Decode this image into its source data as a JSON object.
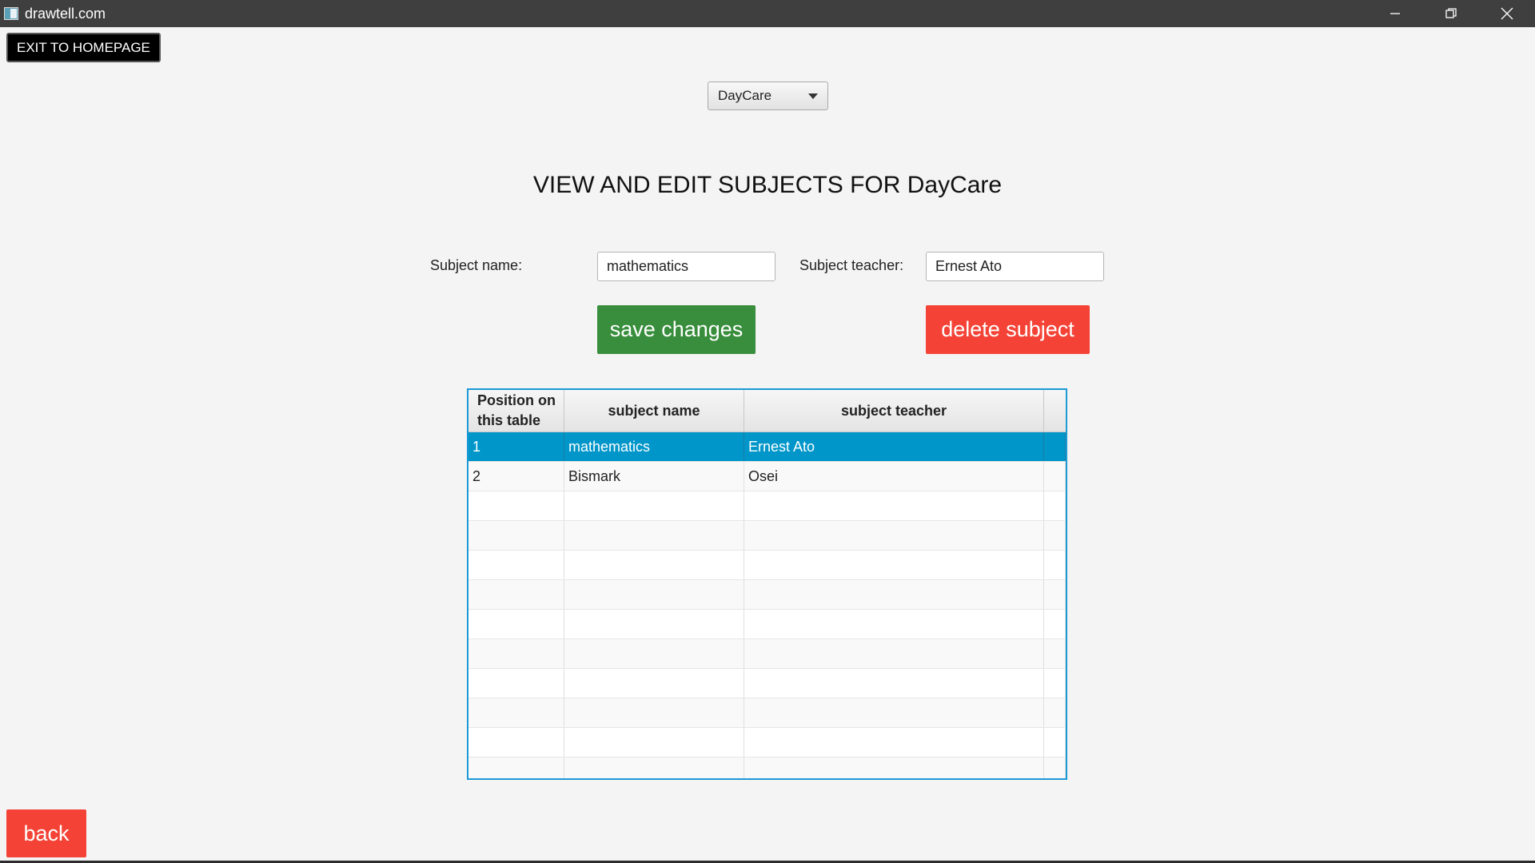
{
  "window": {
    "title": "drawtell.com"
  },
  "toolbar": {
    "exit_label": "EXIT TO HOMEPAGE"
  },
  "class_select": {
    "selected": "DayCare"
  },
  "page_title": "VIEW AND EDIT SUBJECTS FOR DayCare",
  "form": {
    "subject_name_label": "Subject name:",
    "subject_name_value": "mathematics",
    "subject_teacher_label": "Subject teacher:",
    "subject_teacher_value": "Ernest Ato"
  },
  "actions": {
    "save_label": "save changes",
    "delete_label": "delete subject",
    "back_label": "back"
  },
  "table": {
    "columns": [
      "Position on this table",
      "subject name",
      "subject teacher"
    ],
    "rows": [
      {
        "position": "1",
        "subject": "mathematics",
        "teacher": "Ernest Ato"
      },
      {
        "position": "2",
        "subject": "Bismark",
        "teacher": "Osei"
      }
    ],
    "selected_row": 0
  },
  "colors": {
    "accent": "#1b9ad6",
    "selected_row": "#0096c9",
    "save": "#388e3c",
    "delete": "#f44336"
  }
}
